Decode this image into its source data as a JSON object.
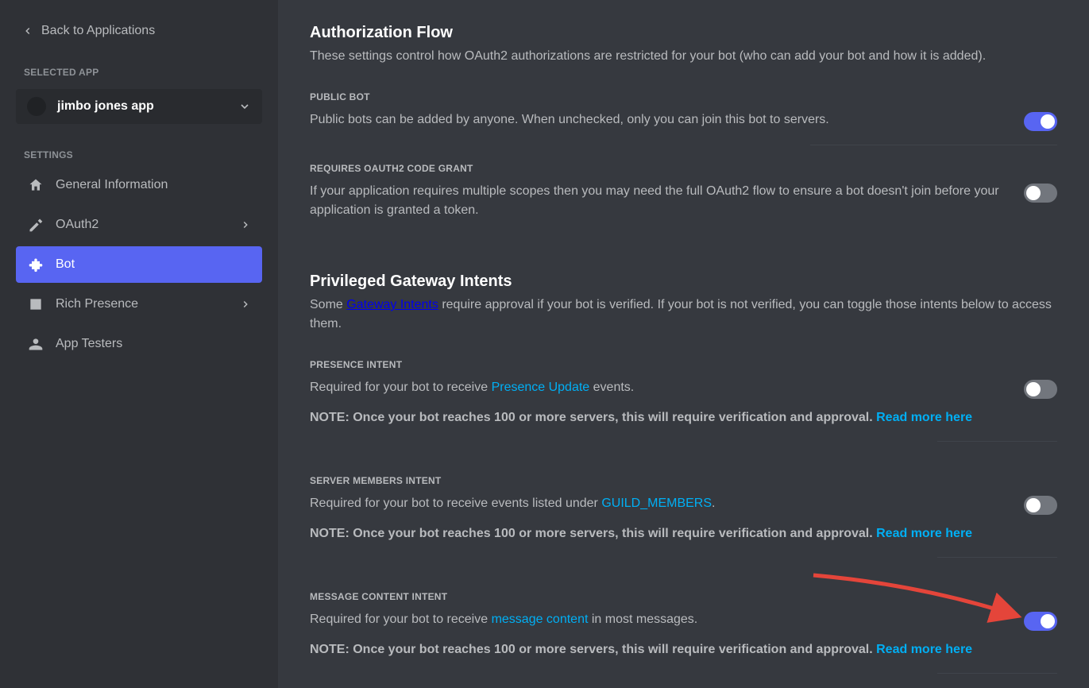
{
  "sidebar": {
    "back_label": "Back to Applications",
    "selected_app_header": "Selected App",
    "selected_app_name": "jimbo jones app",
    "settings_header": "Settings",
    "nav": [
      {
        "label": "General Information",
        "icon": "home",
        "chevron": false,
        "active": false
      },
      {
        "label": "OAuth2",
        "icon": "wrench",
        "chevron": true,
        "active": false
      },
      {
        "label": "Bot",
        "icon": "puzzle",
        "chevron": false,
        "active": true
      },
      {
        "label": "Rich Presence",
        "icon": "doc",
        "chevron": true,
        "active": false
      },
      {
        "label": "App Testers",
        "icon": "people",
        "chevron": false,
        "active": false
      }
    ]
  },
  "main": {
    "authflow": {
      "title": "Authorization Flow",
      "desc": "These settings control how OAuth2 authorizations are restricted for your bot (who can add your bot and how it is added)."
    },
    "public_bot": {
      "header": "Public Bot",
      "desc": "Public bots can be added by anyone. When unchecked, only you can join this bot to servers.",
      "enabled": true
    },
    "code_grant": {
      "header": "Requires OAuth2 Code Grant",
      "desc": "If your application requires multiple scopes then you may need the full OAuth2 flow to ensure a bot doesn't join before your application is granted a token.",
      "enabled": false
    },
    "gateway": {
      "title": "Privileged Gateway Intents",
      "desc_pre": "Some ",
      "desc_link": "Gateway Intents",
      "desc_post": " require approval if your bot is verified. If your bot is not verified, you can toggle those intents below to access them."
    },
    "presence": {
      "header": "Presence Intent",
      "desc_pre": "Required for your bot to receive ",
      "desc_link": "Presence Update",
      "desc_post": " events.",
      "note_pre": "NOTE: Once your bot reaches 100 or more servers, this will require verification and approval. ",
      "note_link": "Read more here",
      "enabled": false
    },
    "members": {
      "header": "Server Members Intent",
      "desc_pre": "Required for your bot to receive events listed under ",
      "desc_link": "GUILD_MEMBERS",
      "desc_post": ".",
      "note_pre": "NOTE: Once your bot reaches 100 or more servers, this will require verification and approval. ",
      "note_link": "Read more here",
      "enabled": false
    },
    "message_content": {
      "header": "Message Content Intent",
      "desc_pre": "Required for your bot to receive ",
      "desc_link": "message content",
      "desc_post": " in most messages.",
      "note_pre": "NOTE: Once your bot reaches 100 or more servers, this will require verification and approval. ",
      "note_link": "Read more here",
      "enabled": true
    }
  },
  "annotation": {
    "arrow_color": "#e4453a"
  }
}
